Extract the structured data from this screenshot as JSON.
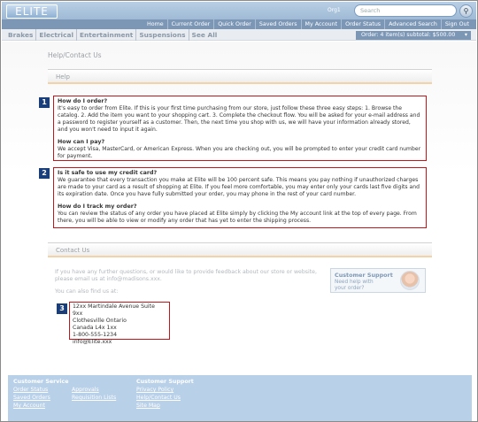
{
  "header": {
    "logo_text": "ELITE",
    "org": "Org1",
    "search_placeholder": "Search",
    "nav": [
      "Home",
      "Current Order",
      "Quick Order",
      "Saved Orders",
      "My Account",
      "Order Status",
      "Advanced Search",
      "Sign Out"
    ]
  },
  "categories": [
    "Brakes",
    "Electrical",
    "Entertainment",
    "Suspensions",
    "See All"
  ],
  "order_summary": "Order: 4 item(s) subtotal: $500.00",
  "page_title": "Help/Contact Us",
  "help": {
    "heading": "Help",
    "faq1": [
      {
        "q": "How do I order?",
        "a": "It's easy to order from Elite. If this is your first time purchasing from our store, just follow these three easy steps: 1. Browse the catalog. 2. Add the item you want to your shopping cart. 3. Complete the checkout flow. You will be asked for your e-mail address and a password to register yourself as a customer. Then, the next time you shop with us, we will have your information already stored, and you won't need to input it again."
      },
      {
        "q": "How can I pay?",
        "a": "We accept Visa, MasterCard, or American Express. When you are checking out, you will be prompted to enter your credit card number for payment."
      }
    ],
    "faq2": [
      {
        "q": "Is it safe to use my credit card?",
        "a": "We guarantee that every transaction you make at Elite will be 100 percent safe. This means you pay nothing if unauthorized charges are made to your card as a result of shopping at Elite. If you feel more comfortable, you may enter only your cards last five digits and its expiration date. Once you have fully submitted your order, you may phone in the rest of your card number."
      },
      {
        "q": "How do I track my order?",
        "a": "You can review the status of any order you have placed at Elite simply by clicking the My account link at the top of every page. From there, you will be able to view or modify any order that has yet to enter the shipping process."
      }
    ]
  },
  "contact": {
    "heading": "Contact Us",
    "intro": "If you have any further questions, or would like to provide feedback about our store or website, please email us at info@madisons.xxx.",
    "find_us": "You can also find us at:",
    "address": [
      "12xx Martindale Avenue Suite 9xx",
      "Clothesville Ontario",
      "Canada L4x 1xx",
      "1-800-555-1234",
      "info@Elite.xxx"
    ],
    "support_title": "Customer Support",
    "support_sub": [
      "Need help with",
      "your order?"
    ]
  },
  "footer": {
    "col1_head": "Customer Service",
    "col1_links": [
      "Order Status",
      "Saved Orders",
      "My Account"
    ],
    "col2_links": [
      "Approvals",
      "Requisition Lists"
    ],
    "col3_head": "Customer Support",
    "col3_links": [
      "Privacy Policy",
      "Help/Contact Us",
      "Site Map"
    ]
  },
  "callout_numbers": [
    "1",
    "2",
    "3"
  ]
}
